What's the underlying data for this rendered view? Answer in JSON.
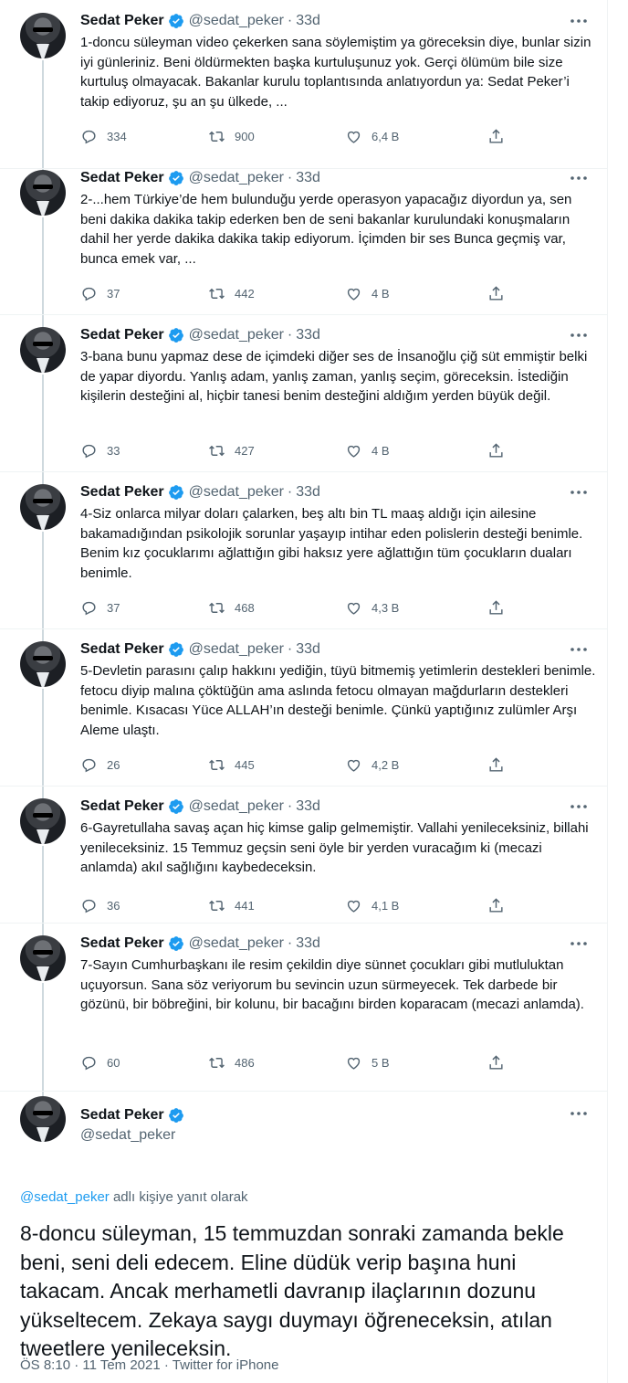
{
  "author": {
    "name": "Sedat Peker",
    "handle": "@sedat_peker",
    "verified": true
  },
  "icons": {
    "reply": "reply-icon",
    "retweet": "retweet-icon",
    "like": "heart-icon",
    "share": "share-icon",
    "more": "more-icon",
    "verified": "verified-badge-icon"
  },
  "colors": {
    "accent": "#1d9bf0",
    "secondary_text": "#536471",
    "divider": "#eff3f4"
  },
  "tweets": [
    {
      "time": "33d",
      "text": "1-doncu süleyman video çekerken sana söylemiştim ya göreceksin diye, bunlar sizin iyi günleriniz. Beni öldürmekten başka kurtuluşunuz yok. Gerçi ölümüm bile size kurtuluş olmayacak. Bakanlar kurulu toplantısında anlatıyordun ya: Sedat Peker’i takip ediyoruz, şu an şu ülkede, ...",
      "replies": "334",
      "retweets": "900",
      "likes": "6,4 B"
    },
    {
      "time": "33d",
      "text": "2-...hem Türkiye’de hem bulunduğu yerde operasyon yapacağız diyordun ya, sen beni dakika dakika takip ederken ben de seni bakanlar kurulundaki konuşmaların dahil her yerde dakika dakika takip ediyorum. İçimden bir ses Bunca geçmiş var, bunca emek var, ...",
      "replies": "37",
      "retweets": "442",
      "likes": "4 B"
    },
    {
      "time": "33d",
      "text": "3-bana bunu yapmaz dese de içimdeki diğer ses de İnsanoğlu çiğ süt emmiştir belki de yapar diyordu. Yanlış adam, yanlış zaman, yanlış seçim, göreceksin. İstediğin kişilerin desteğini al, hiçbir tanesi benim desteğini aldığım yerden büyük değil.",
      "replies": "33",
      "retweets": "427",
      "likes": "4 B"
    },
    {
      "time": "33d",
      "text": "4-Siz onlarca milyar doları çalarken, beş altı bin TL maaş aldığı için ailesine bakamadığından psikolojik sorunlar yaşayıp intihar eden polislerin desteği benimle. Benim kız çocuklarımı ağlattığın gibi haksız yere ağlattığın tüm çocukların duaları benimle.",
      "replies": "37",
      "retweets": "468",
      "likes": "4,3 B"
    },
    {
      "time": "33d",
      "text": "5-Devletin parasını çalıp hakkını yediğin, tüyü bitmemiş yetimlerin destekleri benimle. fetocu diyip malına çöktüğün ama aslında fetocu olmayan mağdurların destekleri benimle. Kısacası Yüce ALLAH’ın desteği benimle. Çünkü yaptığınız zulümler Arşı Aleme ulaştı.",
      "replies": "26",
      "retweets": "445",
      "likes": "4,2 B"
    },
    {
      "time": "33d",
      "text": "6-Gayretullaha savaş açan hiç kimse galip gelmemiştir. Vallahi yenileceksiniz, billahi yenileceksiniz. 15 Temmuz geçsin seni öyle bir yerden vuracağım ki (mecazi anlamda) akıl sağlığını kaybedeceksin.",
      "replies": "36",
      "retweets": "441",
      "likes": "4,1 B"
    },
    {
      "time": "33d",
      "text": "7-Sayın Cumhurbaşkanı ile resim çekildin diye sünnet çocukları gibi mutluluktan uçuyorsun. Sana söz veriyorum bu sevincin uzun sürmeyecek. Tek darbede bir gözünü, bir böbreğini, bir kolunu, bir bacağını birden koparacam (mecazi anlamda).",
      "replies": "60",
      "retweets": "486",
      "likes": "5 B"
    }
  ],
  "main_tweet": {
    "replying_prefix": "@sedat_peker",
    "replying_suffix": " adlı kişiye yanıt olarak",
    "text": "8-doncu süleyman, 15 temmuzdan sonraki zamanda bekle beni, seni deli edecem. Eline düdük verip başına huni takacam. Ancak merhametli davranıp ilaçlarının dozunu yükseltecem. Zekaya saygı duymayı öğreneceksin, atılan tweetlere yenileceksin.",
    "timestamp": "ÖS 8:10 · 11 Tem 2021 · Twitter for iPhone"
  }
}
